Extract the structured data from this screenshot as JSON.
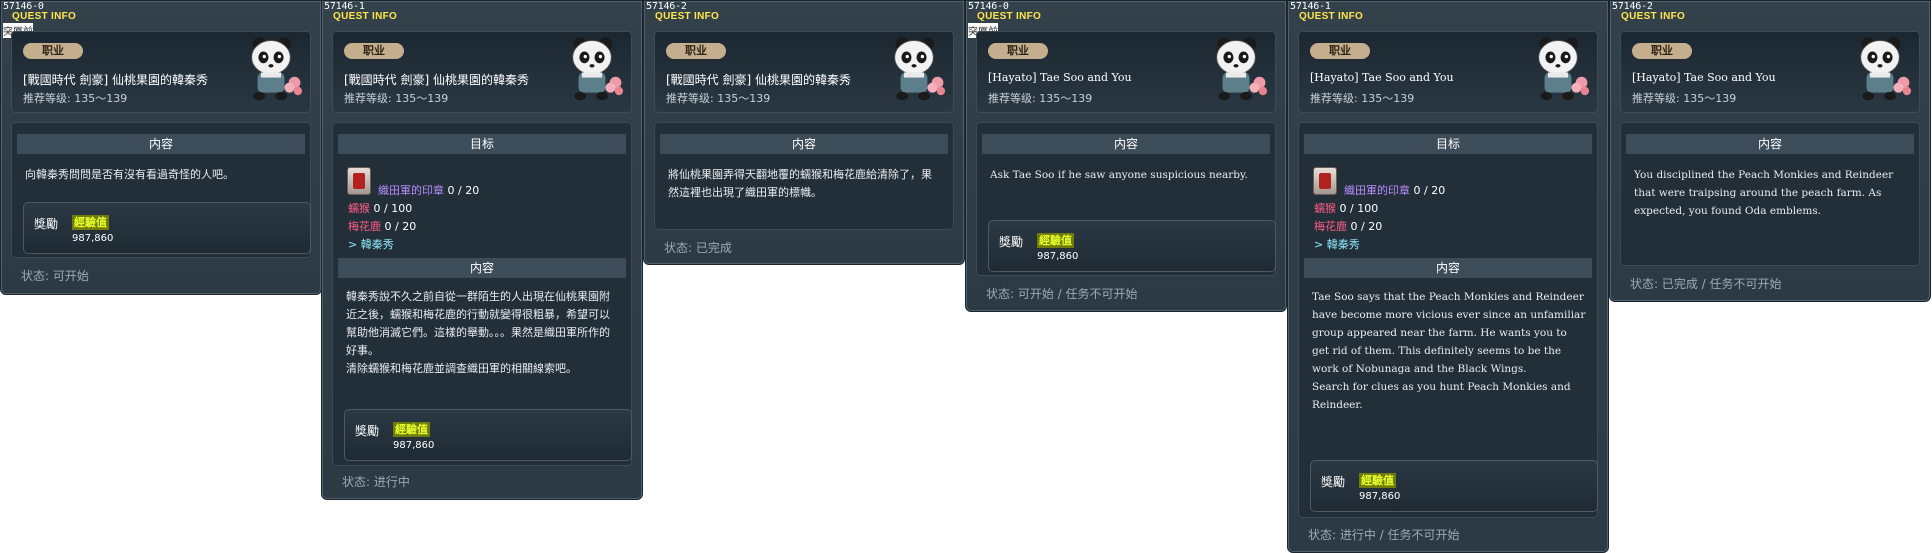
{
  "cards": [
    {
      "id": "57146-0",
      "title": "QUEST INFO",
      "tag": "突厦前",
      "job": "职业",
      "name": "[戰國時代 劍豪] 仙桃果園的韓秦秀",
      "rec_level": "推荐等级: 135～139",
      "content_header": "内容",
      "content": "向韓秦秀問問是否有沒有看過奇怪的人吧。",
      "reward_label": "獎勵",
      "exp_label": "經驗值",
      "exp": "987,860",
      "status": "状态: 可开始"
    },
    {
      "id": "57146-1",
      "title": "QUEST INFO",
      "job": "职业",
      "name": "[戰國時代 劍豪] 仙桃果園的韓秦秀",
      "rec_level": "推荐等级: 135～139",
      "target_header": "目标",
      "target_item": "織田軍的印章",
      "target_item_count": "0 / 20",
      "mob1": "蠕猴",
      "mob1_count": "0 / 100",
      "mob2": "梅花鹿",
      "mob2_count": "0 / 20",
      "npc": "> 韓秦秀",
      "content_header": "内容",
      "content": "韓秦秀說不久之前自從一群陌生的人出現在仙桃果園附近之後，蠕猴和梅花鹿的行動就變得很粗暴，希望可以幫助他消滅它們。這樣的舉動。。。果然是織田軍所作的好事。\n清除蠕猴和梅花鹿並調查織田軍的相關線索吧。",
      "reward_label": "獎勵",
      "exp_label": "經驗值",
      "exp": "987,860",
      "status": "状态: 进行中"
    },
    {
      "id": "57146-2",
      "title": "QUEST INFO",
      "job": "职业",
      "name": "[戰國時代 劍豪] 仙桃果園的韓秦秀",
      "rec_level": "推荐等级: 135～139",
      "content_header": "内容",
      "content": "將仙桃果園弄得天翻地覆的蠕猴和梅花鹿給清除了，果然這裡也出現了織田軍的標幟。",
      "status": "状态: 已完成"
    },
    {
      "id": "57146-0",
      "title": "QUEST INFO",
      "tag": "突厦前",
      "job": "职业",
      "name": "[Hayato] Tae Soo and You",
      "rec_level": "推荐等级: 135～139",
      "content_header": "内容",
      "content": "Ask Tae Soo if he saw anyone suspicious nearby.",
      "reward_label": "獎勵",
      "exp_label": "經驗值",
      "exp": "987,860",
      "status": "状态: 可开始 / 任务不可开始"
    },
    {
      "id": "57146-1",
      "title": "QUEST INFO",
      "job": "职业",
      "name": "[Hayato] Tae Soo and You",
      "rec_level": "推荐等级: 135～139",
      "target_header": "目标",
      "target_item": "織田軍的印章",
      "target_item_count": "0 / 20",
      "mob1": "蠕猴",
      "mob1_count": "0 / 100",
      "mob2": "梅花鹿",
      "mob2_count": "0 / 20",
      "npc": "> 韓秦秀",
      "content_header": "内容",
      "content": "Tae Soo says that the Peach Monkies and Reindeer have become more vicious ever since an unfamiliar group appeared near the farm. He wants you to get rid of them. This definitely seems to be the work of Nobunaga and the Black Wings.\nSearch for clues as you hunt Peach Monkies and Reindeer.",
      "reward_label": "獎勵",
      "exp_label": "經驗值",
      "exp": "987,860",
      "status": "状态: 进行中 / 任务不可开始"
    },
    {
      "id": "57146-2",
      "title": "QUEST INFO",
      "job": "职业",
      "name": "[Hayato] Tae Soo and You",
      "rec_level": "推荐等级: 135～139",
      "content_header": "内容",
      "content": "You disciplined the Peach Monkies and Reindeer that were traipsing around the peach farm. As expected, you found Oda emblems.",
      "status": "状态: 已完成 / 任务不可开始"
    }
  ],
  "colors": {
    "title": "#ffe44a",
    "exp_badge": "#e8ff2c",
    "target_item": "#b98bff",
    "mob": "#ff5b86",
    "npc": "#8feaff",
    "status": "#9fa9b1"
  },
  "icons": [
    "panda-npc-icon",
    "seal-item-icon"
  ]
}
